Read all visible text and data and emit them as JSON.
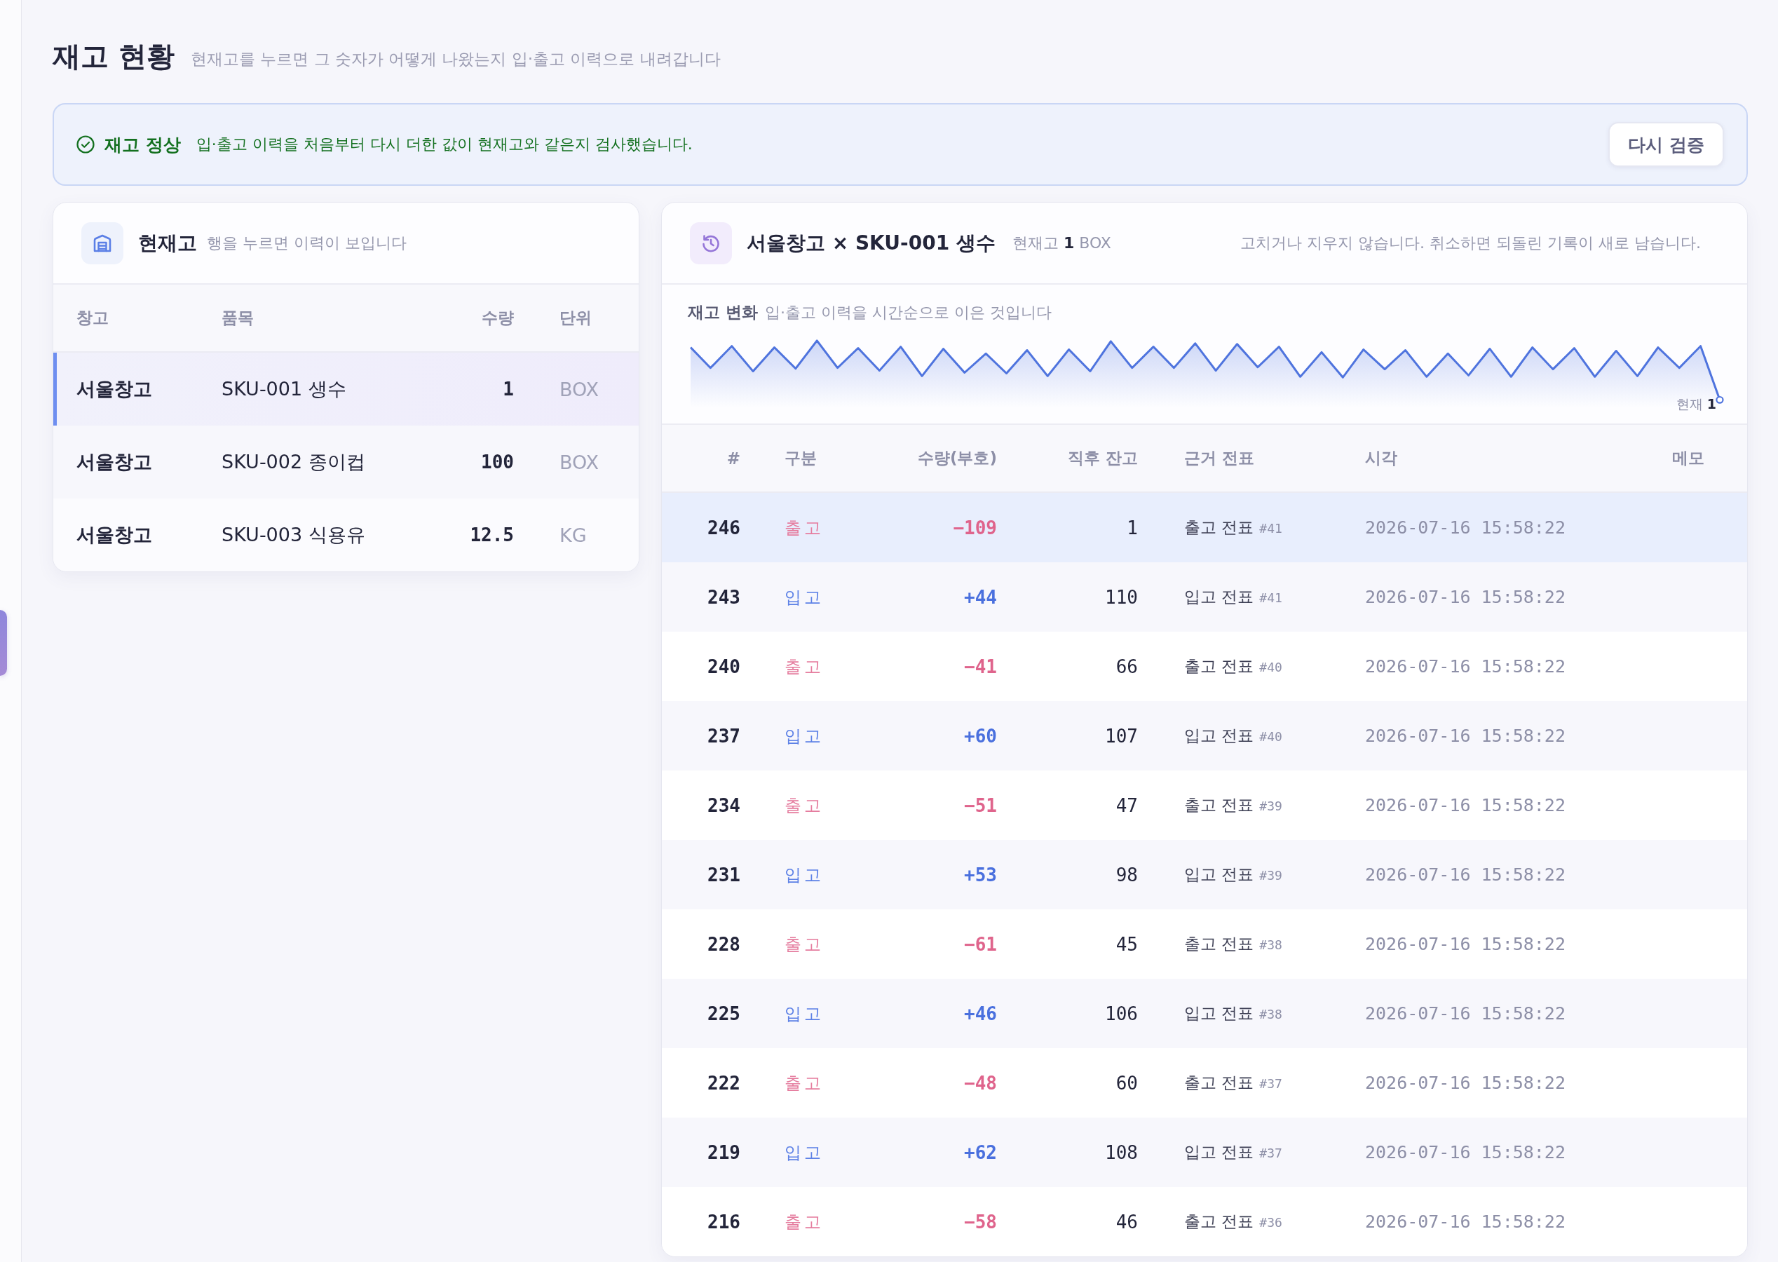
{
  "page": {
    "title": "재고 현황",
    "subtitle": "현재고를 누르면 그 숫자가 어떻게 나왔는지 입·출고 이력으로 내려갑니다"
  },
  "banner": {
    "title": "재고 정상",
    "message": "입·출고 이력을 처음부터 다시 더한 값이 현재고와 같은지 검사했습니다.",
    "button": "다시 검증"
  },
  "stock": {
    "title": "현재고",
    "hint": "행을 누르면 이력이 보입니다",
    "columns": [
      "창고",
      "품목",
      "수량",
      "단위"
    ],
    "rows": [
      {
        "warehouse": "서울창고",
        "item": "SKU-001 생수",
        "qty": "1",
        "unit": "BOX",
        "selected": true
      },
      {
        "warehouse": "서울창고",
        "item": "SKU-002 종이컵",
        "qty": "100",
        "unit": "BOX",
        "selected": false
      },
      {
        "warehouse": "서울창고",
        "item": "SKU-003 식용유",
        "qty": "12.5",
        "unit": "KG",
        "selected": false
      }
    ]
  },
  "history": {
    "title": "서울창고 × SKU-001 생수",
    "summary": "현재고 **1** BOX",
    "note": "고치거나 지우지 않습니다. 취소하면 되돌린 기록이 새로 남습니다.",
    "chart": {
      "title": "재고 변화",
      "hint": "입·출고 이력을 시간순으로 이은 것입니다",
      "end_label": "현재 **1**"
    },
    "columns": [
      "#",
      "구분",
      "수량(부호)",
      "직후 잔고",
      "근거 전표",
      "시각",
      "메모"
    ],
    "rows": [
      {
        "no": "246",
        "kind": "out",
        "type": "출고",
        "qty": "−109",
        "balance": "1",
        "voucher": "출고 전표",
        "voucher_no": "#41",
        "time": "2026-07-16 15:58:22",
        "current": true
      },
      {
        "no": "243",
        "kind": "in",
        "type": "입고",
        "qty": "+44",
        "balance": "110",
        "voucher": "입고 전표",
        "voucher_no": "#41",
        "time": "2026-07-16 15:58:22",
        "current": false
      },
      {
        "no": "240",
        "kind": "out",
        "type": "출고",
        "qty": "−41",
        "balance": "66",
        "voucher": "출고 전표",
        "voucher_no": "#40",
        "time": "2026-07-16 15:58:22",
        "current": false
      },
      {
        "no": "237",
        "kind": "in",
        "type": "입고",
        "qty": "+60",
        "balance": "107",
        "voucher": "입고 전표",
        "voucher_no": "#40",
        "time": "2026-07-16 15:58:22",
        "current": false
      },
      {
        "no": "234",
        "kind": "out",
        "type": "출고",
        "qty": "−51",
        "balance": "47",
        "voucher": "출고 전표",
        "voucher_no": "#39",
        "time": "2026-07-16 15:58:22",
        "current": false
      },
      {
        "no": "231",
        "kind": "in",
        "type": "입고",
        "qty": "+53",
        "balance": "98",
        "voucher": "입고 전표",
        "voucher_no": "#39",
        "time": "2026-07-16 15:58:22",
        "current": false
      },
      {
        "no": "228",
        "kind": "out",
        "type": "출고",
        "qty": "−61",
        "balance": "45",
        "voucher": "출고 전표",
        "voucher_no": "#38",
        "time": "2026-07-16 15:58:22",
        "current": false
      },
      {
        "no": "225",
        "kind": "in",
        "type": "입고",
        "qty": "+46",
        "balance": "106",
        "voucher": "입고 전표",
        "voucher_no": "#38",
        "time": "2026-07-16 15:58:22",
        "current": false
      },
      {
        "no": "222",
        "kind": "out",
        "type": "출고",
        "qty": "−48",
        "balance": "60",
        "voucher": "출고 전표",
        "voucher_no": "#37",
        "time": "2026-07-16 15:58:22",
        "current": false
      },
      {
        "no": "219",
        "kind": "in",
        "type": "입고",
        "qty": "+62",
        "balance": "108",
        "voucher": "입고 전표",
        "voucher_no": "#37",
        "time": "2026-07-16 15:58:22",
        "current": false
      },
      {
        "no": "216",
        "kind": "out",
        "type": "출고",
        "qty": "−58",
        "balance": "46",
        "voucher": "출고 전표",
        "voucher_no": "#36",
        "time": "2026-07-16 15:58:22",
        "current": false
      }
    ]
  }
}
